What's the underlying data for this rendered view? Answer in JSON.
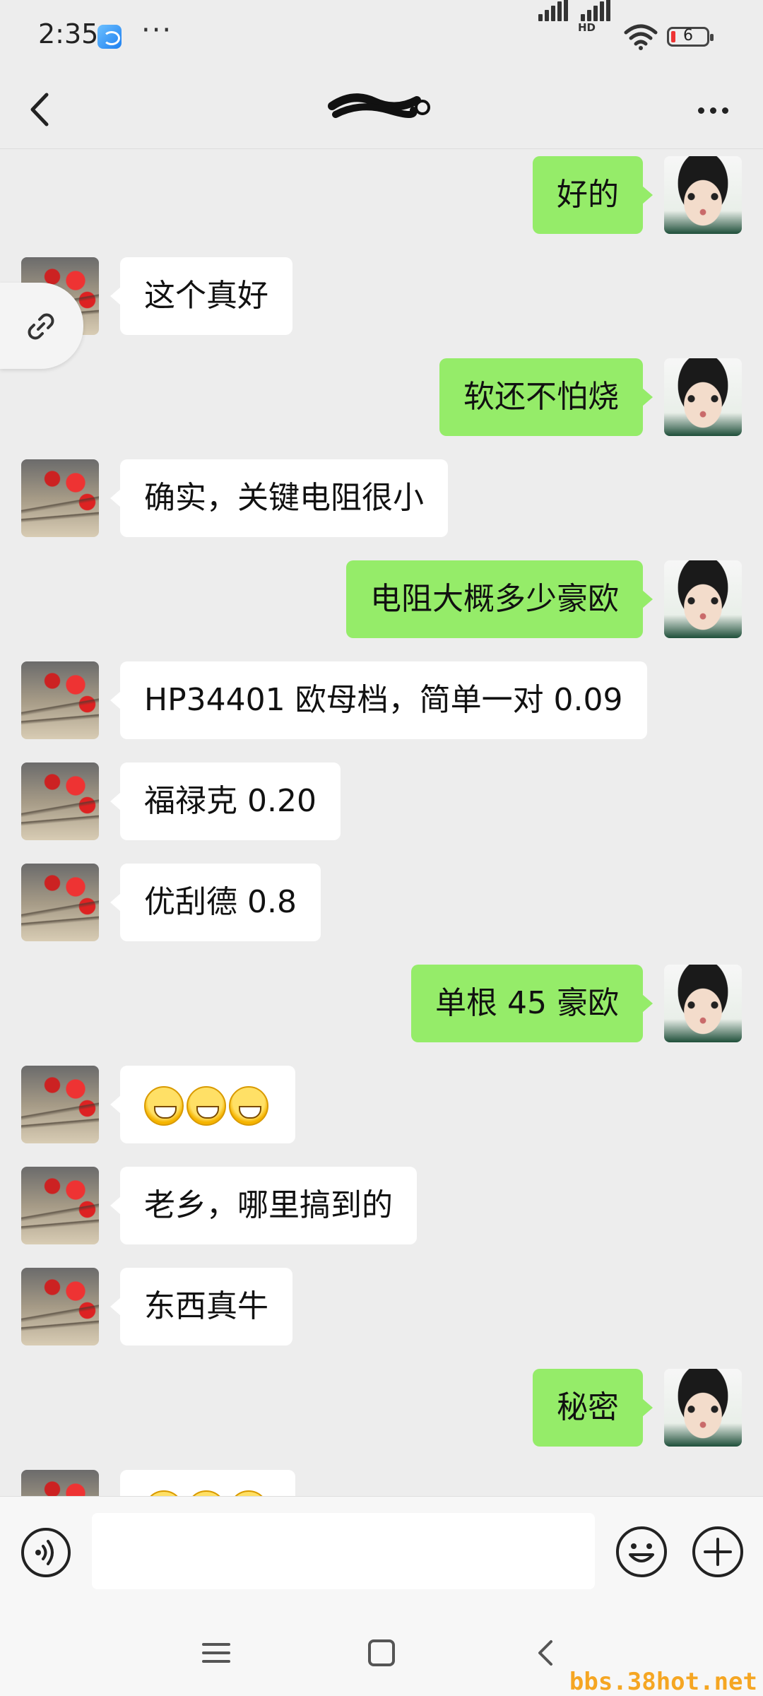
{
  "status_bar": {
    "time": "2:35",
    "more": "···",
    "battery": "6",
    "hd_label": "HD"
  },
  "header": {
    "title": ""
  },
  "messages": [
    {
      "side": "right",
      "text": "好的"
    },
    {
      "side": "left",
      "text": "这个真好"
    },
    {
      "side": "right",
      "text": "软还不怕烧"
    },
    {
      "side": "left",
      "text": "确实，关键电阻很小"
    },
    {
      "side": "right",
      "text": "电阻大概多少豪欧"
    },
    {
      "side": "left",
      "text": "HP34401 欧母档，简单一对 0.09"
    },
    {
      "side": "left",
      "text": "福禄克 0.20"
    },
    {
      "side": "left",
      "text": "优刮德 0.8"
    },
    {
      "side": "right",
      "text": "单根 45 豪欧"
    },
    {
      "side": "left",
      "emoji_count": 3,
      "icon": "grinning-emoji"
    },
    {
      "side": "left",
      "text": "老乡，哪里搞到的"
    },
    {
      "side": "left",
      "text": "东西真牛"
    },
    {
      "side": "right",
      "text": "秘密"
    },
    {
      "side": "left",
      "emoji_count": 3,
      "icon": "grinning-emoji"
    }
  ],
  "input": {
    "value": "",
    "placeholder": ""
  },
  "icons": {
    "back": "chevron-left-icon",
    "more": "more-icon",
    "link": "link-icon",
    "voice": "voice-icon",
    "emoji": "smiley-icon",
    "plus": "plus-icon"
  },
  "colors": {
    "self_bubble": "#95ec69",
    "other_bubble": "#ffffff",
    "background": "#ededed"
  },
  "watermark": "bbs.38hot.net"
}
